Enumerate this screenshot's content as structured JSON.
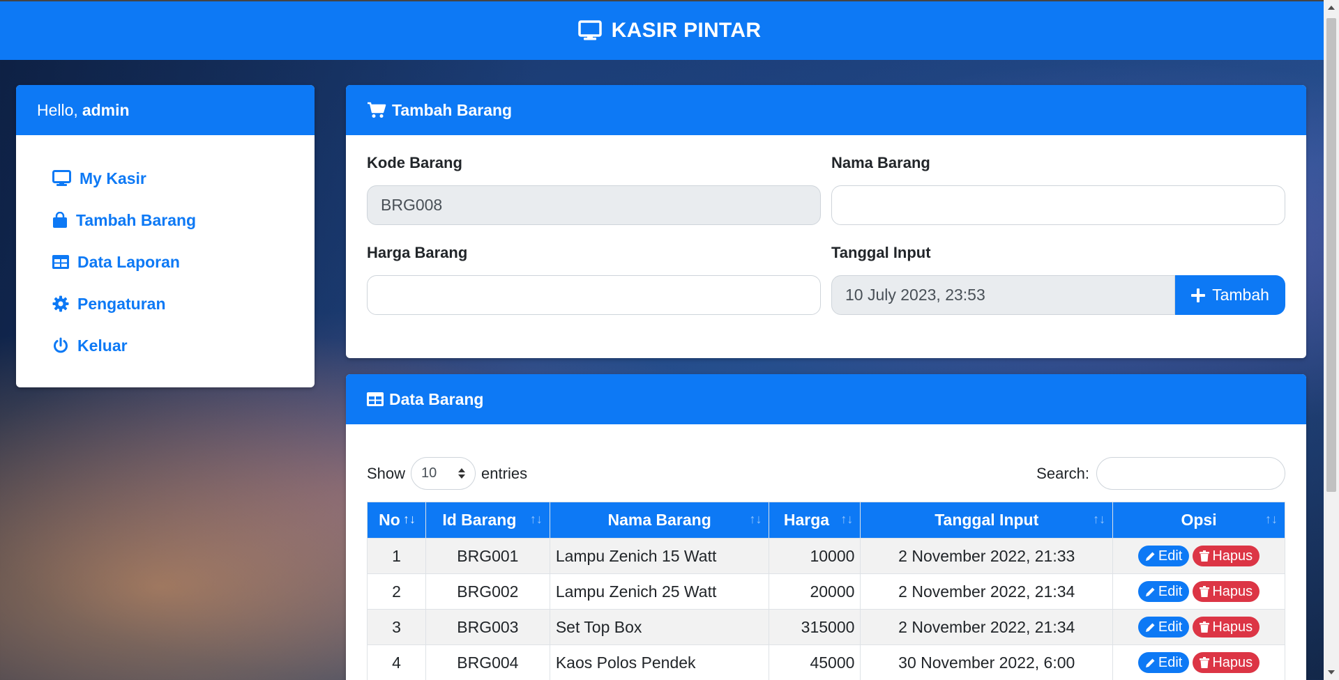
{
  "app": {
    "title": "KASIR PINTAR"
  },
  "colors": {
    "primary": "#0d79f5",
    "danger": "#dc3545"
  },
  "sidebar": {
    "greeting": "Hello,",
    "user": "admin",
    "items": [
      {
        "label": "My Kasir",
        "icon": "monitor-icon"
      },
      {
        "label": "Tambah Barang",
        "icon": "shopping-bag-icon"
      },
      {
        "label": "Data Laporan",
        "icon": "table-icon"
      },
      {
        "label": "Pengaturan",
        "icon": "gear-icon"
      },
      {
        "label": "Keluar",
        "icon": "power-icon"
      }
    ]
  },
  "form": {
    "title": "Tambah Barang",
    "kode_label": "Kode Barang",
    "kode_value": "BRG008",
    "nama_label": "Nama Barang",
    "nama_value": "",
    "harga_label": "Harga Barang",
    "harga_value": "",
    "tanggal_label": "Tanggal Input",
    "tanggal_value": "10 July 2023, 23:53",
    "submit_label": "Tambah"
  },
  "table": {
    "title": "Data Barang",
    "show_label": "Show",
    "length_value": "10",
    "entries_label": "entries",
    "search_label": "Search:",
    "search_value": "",
    "columns": [
      "No",
      "Id Barang",
      "Nama Barang",
      "Harga",
      "Tanggal Input",
      "Opsi"
    ],
    "edit_label": "Edit",
    "delete_label": "Hapus",
    "rows": [
      {
        "no": "1",
        "id": "BRG001",
        "nama": "Lampu Zenich 15 Watt",
        "harga": "10000",
        "tanggal": "2 November 2022, 21:33"
      },
      {
        "no": "2",
        "id": "BRG002",
        "nama": "Lampu Zenich 25 Watt",
        "harga": "20000",
        "tanggal": "2 November 2022, 21:34"
      },
      {
        "no": "3",
        "id": "BRG003",
        "nama": "Set Top Box",
        "harga": "315000",
        "tanggal": "2 November 2022, 21:34"
      },
      {
        "no": "4",
        "id": "BRG004",
        "nama": "Kaos Polos Pendek",
        "harga": "45000",
        "tanggal": "30 November 2022, 6:00"
      }
    ]
  }
}
